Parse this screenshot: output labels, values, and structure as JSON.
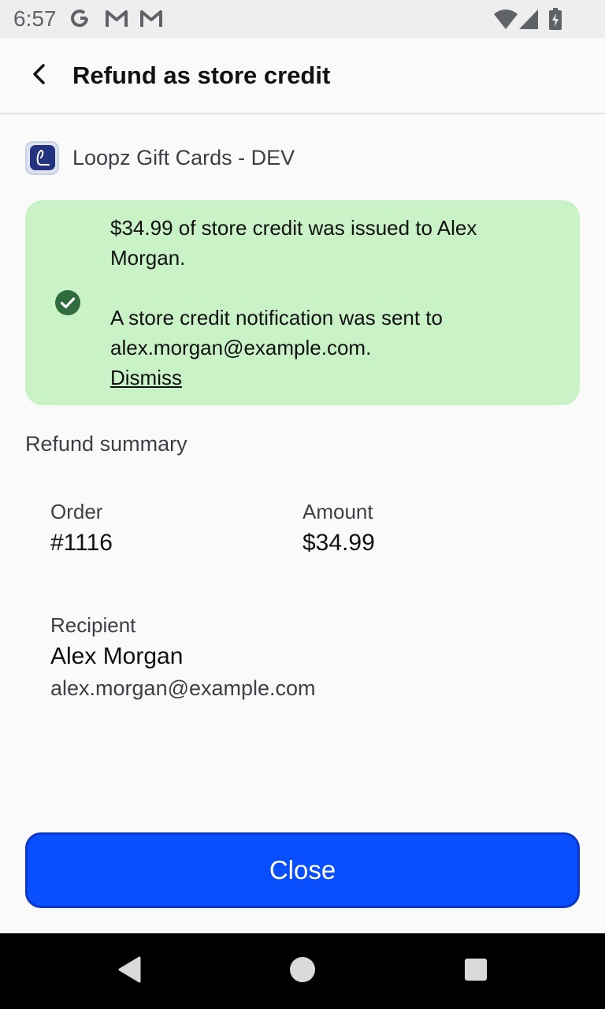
{
  "status_bar": {
    "time": "6:57",
    "notification_icons": [
      "google-icon",
      "gmail-icon",
      "gmail-icon"
    ],
    "system_icons": [
      "wifi-icon",
      "signal-icon",
      "battery-icon"
    ]
  },
  "header": {
    "title": "Refund as store credit",
    "back_icon": "back-arrow-icon"
  },
  "shop": {
    "name": "Loopz Gift Cards - DEV",
    "logo_icon": "loopz-logo-icon"
  },
  "banner": {
    "icon": "check-circle-icon",
    "message_1": "$34.99 of store credit was issued to Alex Morgan.",
    "message_2": "A store credit notification was sent to alex.morgan@example.com.",
    "dismiss_label": "Dismiss"
  },
  "summary": {
    "title": "Refund summary",
    "order_label": "Order",
    "order_value": "#1116",
    "amount_label": "Amount",
    "amount_value": "$34.99",
    "recipient_label": "Recipient",
    "recipient_name": "Alex Morgan",
    "recipient_email": "alex.morgan@example.com"
  },
  "actions": {
    "close_label": "Close"
  },
  "colors": {
    "banner_bg": "#c9f2c7",
    "success_icon": "#2f6b3c",
    "primary_button": "#0a4ffd"
  },
  "nav_bar": {
    "buttons": [
      "back-triangle-icon",
      "home-circle-icon",
      "recents-square-icon"
    ]
  }
}
